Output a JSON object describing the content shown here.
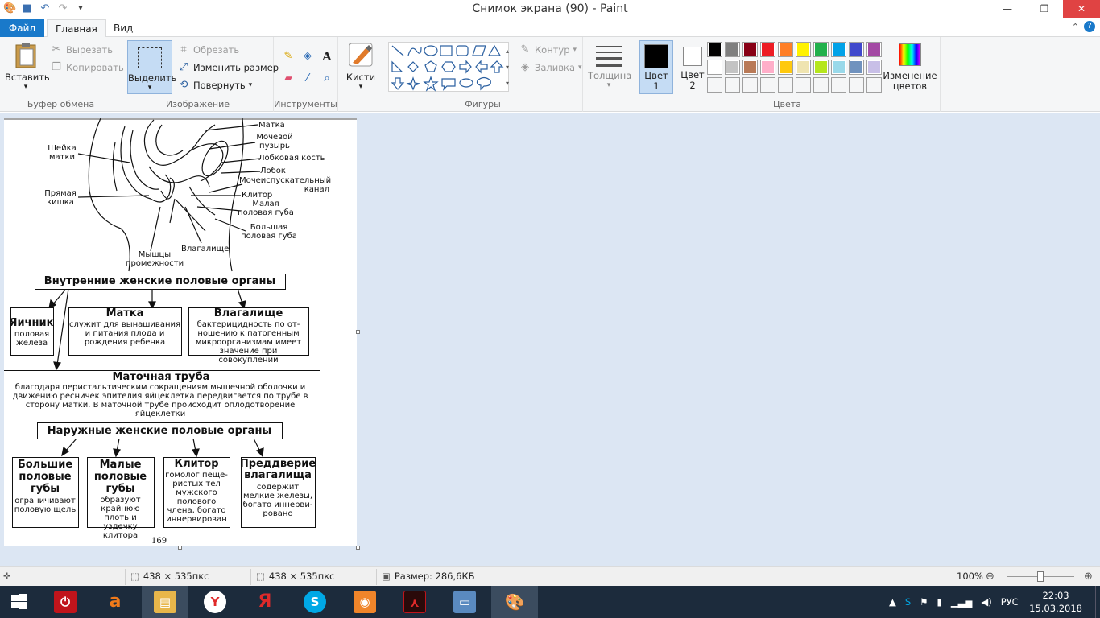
{
  "window": {
    "title": "Снимок экрана (90) - Paint"
  },
  "tabs": {
    "file": "Файл",
    "home": "Главная",
    "view": "Вид"
  },
  "clipboard": {
    "paste": "Вставить",
    "cut": "Вырезать",
    "copy": "Копировать",
    "label": "Буфер обмена"
  },
  "image": {
    "select": "Выделить",
    "crop": "Обрезать",
    "resize": "Изменить размер",
    "rotate": "Повернуть",
    "label": "Изображение"
  },
  "tools": {
    "label": "Инструменты"
  },
  "brushes": {
    "label": "Кисти"
  },
  "shapes": {
    "outline": "Контур",
    "fill": "Заливка",
    "label": "Фигуры"
  },
  "size": {
    "label": "Толщина"
  },
  "colors": {
    "color1": "Цвет 1",
    "color2": "Цвет 2",
    "edit": "Изменение цветов",
    "label": "Цвета",
    "palette": [
      "#000000",
      "#7f7f7f",
      "#880015",
      "#ed1c24",
      "#ff7f27",
      "#fff200",
      "#22b14c",
      "#00a2e8",
      "#3f48cc",
      "#a349a4",
      "#ffffff",
      "#c3c3c3",
      "#b97a57",
      "#ffaec9",
      "#ffc90e",
      "#efe4b0",
      "#b5e61d",
      "#99d9ea",
      "#7092be",
      "#c8bfe7"
    ]
  },
  "diagram": {
    "labels": {
      "uterus": "Матка",
      "bladder": "Мочевой пузырь",
      "pubic_bone": "Лобковая кость",
      "pubis": "Лобок",
      "urethra": "Мочеиспускательный канал",
      "clitoris": "Клитор",
      "labia_minora": "Малая половая губа",
      "labia_majora": "Большая половая губа",
      "vagina_label": "Влагалище",
      "perineum": "Мышцы промежности",
      "cervix": "Шейка матки",
      "rectum": "Прямая кишка"
    },
    "internal_title": "Внутренние женские половые органы",
    "ovary": {
      "title": "Яичник",
      "text": "половая железа"
    },
    "uterus_box": {
      "title": "Матка",
      "text": "служит для вынашивания и питания плода и рождения ребенка"
    },
    "vagina_box": {
      "title": "Влагалище",
      "text": "бактерицидность по от- ношению к патогенным микроорганизмам имеет значение при совокуплении"
    },
    "tube": {
      "title": "Маточная труба",
      "text": "благодаря перистальтическим сокращениям мышечной оболочки и движению ресничек эпителия яйцеклетка передвигается по трубе в сторону матки. В маточной трубе происходит оплодотворение яйцеклетки"
    },
    "external_title": "Наружные женские половые органы",
    "labia_major_box": {
      "title": "Большие половые губы",
      "text": "ограничивают половую щель"
    },
    "labia_minor_box": {
      "title": "Малые половые губы",
      "text": "образуют крайнюю плоть и уздечку клитора"
    },
    "clitoris_box": {
      "title": "Клитор",
      "text": "гомолог пеще- ристых тел мужского полового члена, богато иннервирован"
    },
    "vestibule_box": {
      "title": "Преддверие влагалища",
      "text": "содержит мелкие железы, богато иннерви- ровано"
    },
    "page_number": "169"
  },
  "status": {
    "selection": "438 × 535пкс",
    "image_size": "438 × 535пкс",
    "file_size": "Размер: 286,6КБ",
    "zoom": "100%"
  },
  "taskbar": {
    "lang": "РУС",
    "time": "22:03",
    "date": "15.03.2018"
  }
}
